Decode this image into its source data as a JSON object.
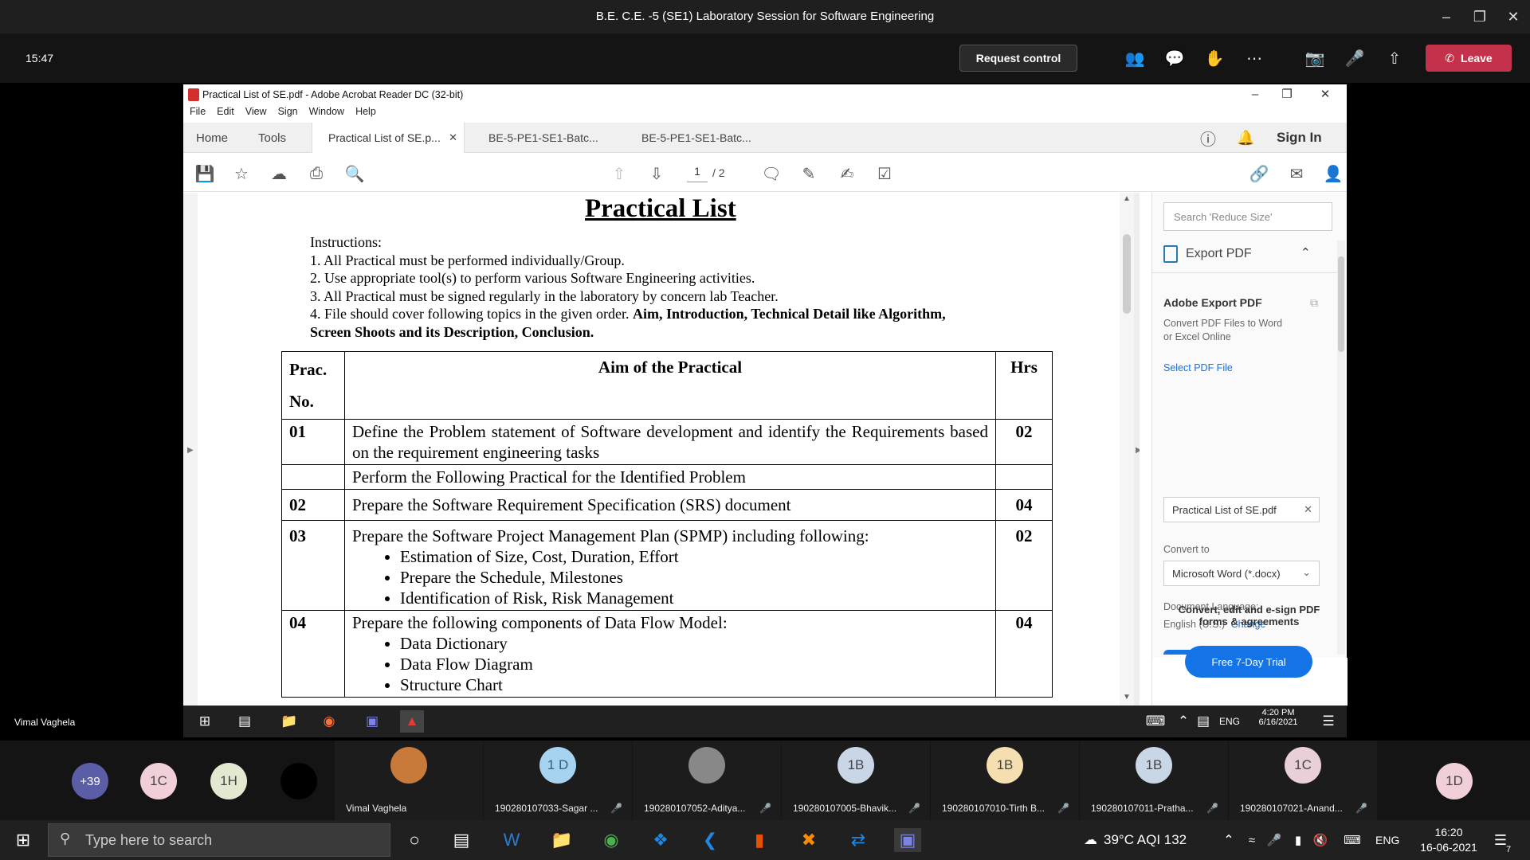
{
  "teams": {
    "window_title": "B.E. C.E. -5 (SE1) Laboratory Session for Software Engineering",
    "clock": "15:47",
    "request_control_label": "Request control",
    "leave_label": "Leave",
    "presenter_name": "Vimal Vaghela"
  },
  "acrobat": {
    "window_title": "Practical List of SE.pdf - Adobe Acrobat Reader DC (32-bit)",
    "menu": [
      "File",
      "Edit",
      "View",
      "Sign",
      "Window",
      "Help"
    ],
    "tabs": {
      "home": "Home",
      "tools": "Tools",
      "doc1": "Practical List of SE.p...",
      "doc2": "BE-5-PE1-SE1-Batc...",
      "doc3": "BE-5-PE1-SE1-Batc..."
    },
    "sign_in": "Sign In",
    "page_current": "1",
    "page_total": "/ 2"
  },
  "document": {
    "title": "Practical List",
    "instructions_heading": "Instructions:",
    "instructions": [
      "1. All Practical must be performed individually/Group.",
      "2. Use appropriate tool(s) to perform various Software Engineering activities.",
      "3. All Practical must be signed regularly in the laboratory by concern lab Teacher."
    ],
    "instruction4_text": "4. File should cover following topics in the given order.",
    "instruction4_bold": "Aim, Introduction, Technical Detail like Algorithm,",
    "instruction4_bold2": "Screen Shoots and its Description, Conclusion.",
    "table_headers": {
      "no": "Prac.",
      "no2": "No.",
      "aim": "Aim of the Practical",
      "hrs": "Hrs"
    },
    "rows": [
      {
        "no": "01",
        "aim": "Define the Problem statement of Software development and identify the Requirements based on the requirement engineering tasks",
        "hrs": "02"
      },
      {
        "no": "",
        "aim": "Perform the Following Practical for the Identified Problem",
        "hrs": ""
      },
      {
        "no": "02",
        "aim": "Prepare the Software Requirement Specification (SRS) document",
        "hrs": "04"
      },
      {
        "no": "03",
        "aim": "Prepare the Software Project Management Plan (SPMP) including following:",
        "hrs": "02",
        "bullets": [
          "Estimation of Size, Cost, Duration, Effort",
          "Prepare the Schedule, Milestones",
          "Identification of Risk, Risk Management"
        ]
      },
      {
        "no": "04",
        "aim": "Prepare the following components of Data Flow Model:",
        "hrs": "04",
        "bullets": [
          "Data Dictionary",
          "Data Flow Diagram",
          "Structure Chart"
        ]
      }
    ]
  },
  "right_pane": {
    "search_placeholder": "Search 'Reduce Size'",
    "export_pdf": "Export PDF",
    "adobe_export_title": "Adobe Export PDF",
    "adobe_export_desc1": "Convert PDF Files to Word",
    "adobe_export_desc2": "or Excel Online",
    "select_file": "Select PDF File",
    "file_name": "Practical List of SE.pdf",
    "convert_to": "Convert to",
    "convert_option": "Microsoft Word (*.docx)",
    "doc_language": "Document Language:",
    "language_value": "English (U.S.)",
    "change_link": "Change",
    "promo1": "Convert, edit and e-sign PDF",
    "promo2": "forms & agreements",
    "trial_button": "Free 7-Day Trial"
  },
  "presenter_taskbar": {
    "time": "4:20 PM",
    "date": "6/16/2021",
    "lang": "ENG"
  },
  "participants": {
    "more": "+39",
    "avatars": [
      "1C",
      "1H"
    ],
    "tiles": [
      {
        "initials": "",
        "name": "Vimal Vaghela",
        "color": "#c87a3a",
        "photo": true
      },
      {
        "initials": "1 D",
        "name": "190280107033-Sagar ...",
        "color": "#a6d4f0"
      },
      {
        "initials": "",
        "name": "190280107052-Aditya...",
        "color": "#888",
        "photo": true
      },
      {
        "initials": "1B",
        "name": "190280107005-Bhavik...",
        "color": "#c9d6e6"
      },
      {
        "initials": "1B",
        "name": "190280107010-Tirth B...",
        "color": "#f5dfb0"
      },
      {
        "initials": "1B",
        "name": "190280107011-Pratha...",
        "color": "#c9d6e6"
      },
      {
        "initials": "1C",
        "name": "190280107021-Anand...",
        "color": "#e8cfd8"
      }
    ],
    "last_avatar": "1D"
  },
  "windows_taskbar": {
    "search_placeholder": "Type here to search",
    "weather": "39°C AQI 132",
    "lang": "ENG",
    "time": "16:20",
    "date": "16-06-2021",
    "notification_count": "7"
  }
}
